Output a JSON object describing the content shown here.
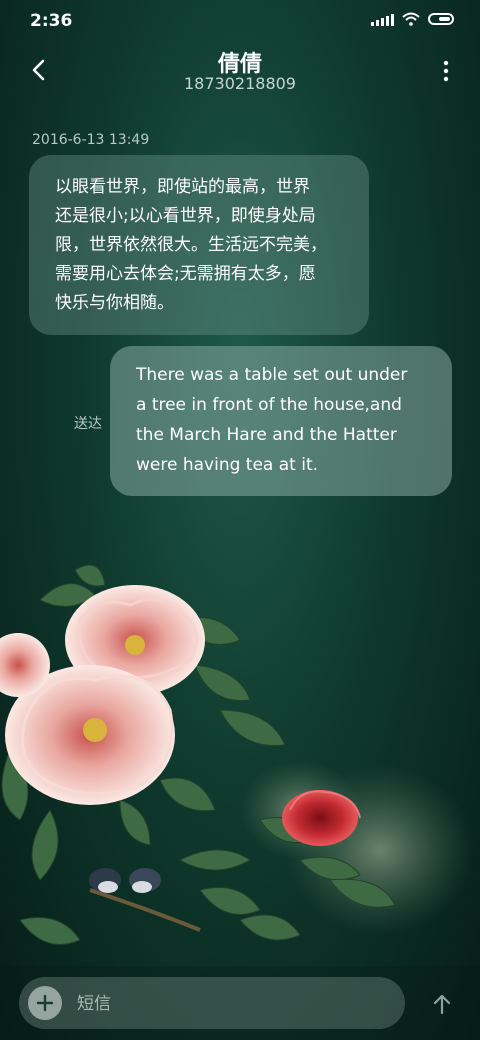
{
  "status_bar": {
    "time": "2:36"
  },
  "header": {
    "contact_name": "倩倩",
    "phone_number": "18730218809"
  },
  "conversation": {
    "timestamp": "2016-6-13 13:49",
    "incoming": {
      "lines": [
        "以眼看世界，即使站的最高，世界",
        "还是很小;以心看世界，即使身处局",
        "限，世界依然很大。生活远不完美，",
        "需要用心去体会;无需拥有太多，愿",
        "快乐与你相随。"
      ]
    },
    "outgoing": {
      "lines": [
        "There was a table set out under",
        "a tree in front of the house,and",
        "the March Hare and the Hatter",
        "were having tea at it."
      ],
      "status": "送达"
    }
  },
  "compose": {
    "placeholder": "短信"
  },
  "icons": {
    "back": "back-arrow-icon",
    "more": "more-vertical-icon",
    "add": "plus-icon",
    "send": "send-arrow-icon",
    "signal": "signal-icon",
    "wifi": "wifi-icon",
    "battery": "battery-icon"
  },
  "colors": {
    "background": "#0f3a2e",
    "bubble_incoming": "#4f7a6c",
    "bubble_outgoing": "#6e978a"
  }
}
